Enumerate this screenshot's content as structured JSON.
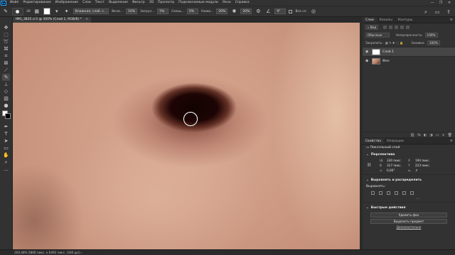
{
  "app": {
    "logo_text": "Ps",
    "menu": [
      "Файл",
      "Редактирование",
      "Изображение",
      "Слои",
      "Текст",
      "Выделение",
      "Фильтр",
      "3D",
      "Просмотр",
      "Подключаемые модули",
      "Окно",
      "Справка"
    ],
    "window_controls": {
      "minimize": "—",
      "maximize": "❐",
      "close": "✕"
    }
  },
  "options_bar": {
    "brush_size": "30",
    "mode_value": "Влажная, слаб. с...",
    "flow_label": "Вкла...",
    "flow_value": "10%",
    "load_label": "Загруз...",
    "load_value": "5%",
    "mix_label": "Смеш...",
    "mix_value": "0%",
    "pressure_label": "Нажи...",
    "pressure_value": "20%",
    "smoothing_value": "20%",
    "angle_value": "0°",
    "all_layers_label": "Все сл."
  },
  "document": {
    "tab_title": "IMG_3835.cr3 @ 300% (Слой 1, RGB/8) *",
    "tab_close": "×"
  },
  "status_bar": {
    "text": "300,48% 5866 пикс. x 6492 пикс. (300 ppi) ›"
  },
  "layers_panel": {
    "tabs": [
      "Слои",
      "Каналы",
      "Контуры"
    ],
    "menu_icon": "≡",
    "filter_label": "Вид",
    "blend_mode": "Обычные",
    "opacity_label": "Непрозрачность:",
    "opacity_value": "100%",
    "lock_label": "Закрепить:",
    "fill_label": "Заливка:",
    "fill_value": "100%",
    "layers": [
      {
        "name": "Слой 1",
        "selected": true,
        "eye": "◉"
      },
      {
        "name": "Фон",
        "selected": false,
        "eye": "◉"
      }
    ],
    "footer_icons": [
      "⛓",
      "fx",
      "◐",
      "◑",
      "▭",
      "+",
      "🗑"
    ]
  },
  "properties_panel": {
    "tabs": [
      "Свойства",
      "Операции"
    ],
    "menu_icon": "≡",
    "layer_kind": "Пиксельный слой",
    "transform_title": "Перспектива",
    "w_label": "Ш",
    "w_value": "330 пикс.",
    "x_label": "X",
    "x_value": "194 пикс.",
    "h_label": "В",
    "h_value": "317 пикс.",
    "y_label": "Y",
    "y_value": "223 пикс.",
    "angle_value": "0,00°",
    "align_title": "Выровнять и распределить",
    "align_label": "Выровнять:",
    "more_dots": "...",
    "quick_title": "Быстрые действия",
    "remove_bg_label": "Удалить фон",
    "select_subject_label": "Выделить предмет",
    "more_link": "Дополнительно"
  },
  "colors": {
    "ui_dark": "#262626",
    "ui_panel": "#323232",
    "accent": "#31a8ff",
    "skin": "#cf9c85"
  }
}
